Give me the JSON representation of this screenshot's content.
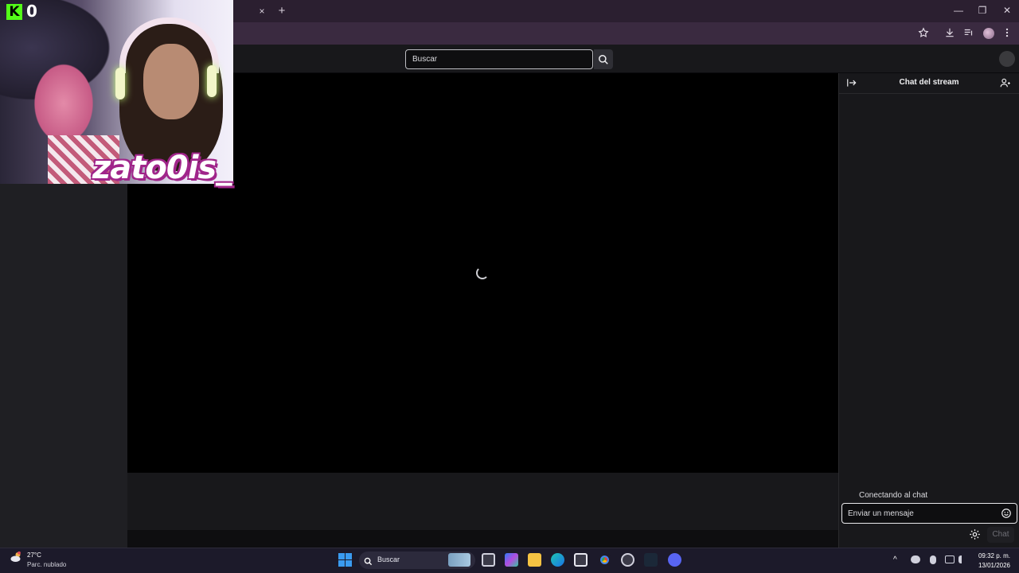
{
  "browser": {
    "tab_close": "×",
    "new_tab": "+",
    "window_controls": {
      "minimize": "—",
      "maximize": "❐",
      "close": "✕"
    }
  },
  "site": {
    "search_placeholder": "Buscar"
  },
  "chat": {
    "title": "Chat del stream",
    "status": "Conectando al chat",
    "input_placeholder": "Enviar un mensaje",
    "send_label": "Chat"
  },
  "overlay": {
    "kick_letter": "K",
    "viewer_count": "0",
    "streamer_name": "zato0is_"
  },
  "taskbar": {
    "weather_temp": "27°C",
    "weather_desc": "Parc. nublado",
    "search_label": "Buscar",
    "time": "09:32 p. m.",
    "date": "13/01/2026"
  },
  "colors": {
    "kick_green": "#53fc18",
    "name_outline": "#a0258a",
    "browser_frame": "#2b1f30"
  },
  "icons": [
    "bookmark-star-icon",
    "download-icon",
    "media-control-icon",
    "profile-avatar",
    "more-menu-icon",
    "search-icon",
    "collapse-chat-icon",
    "community-icon",
    "emote-icon",
    "settings-gear-icon",
    "loading-spinner",
    "windows-start-icon"
  ]
}
